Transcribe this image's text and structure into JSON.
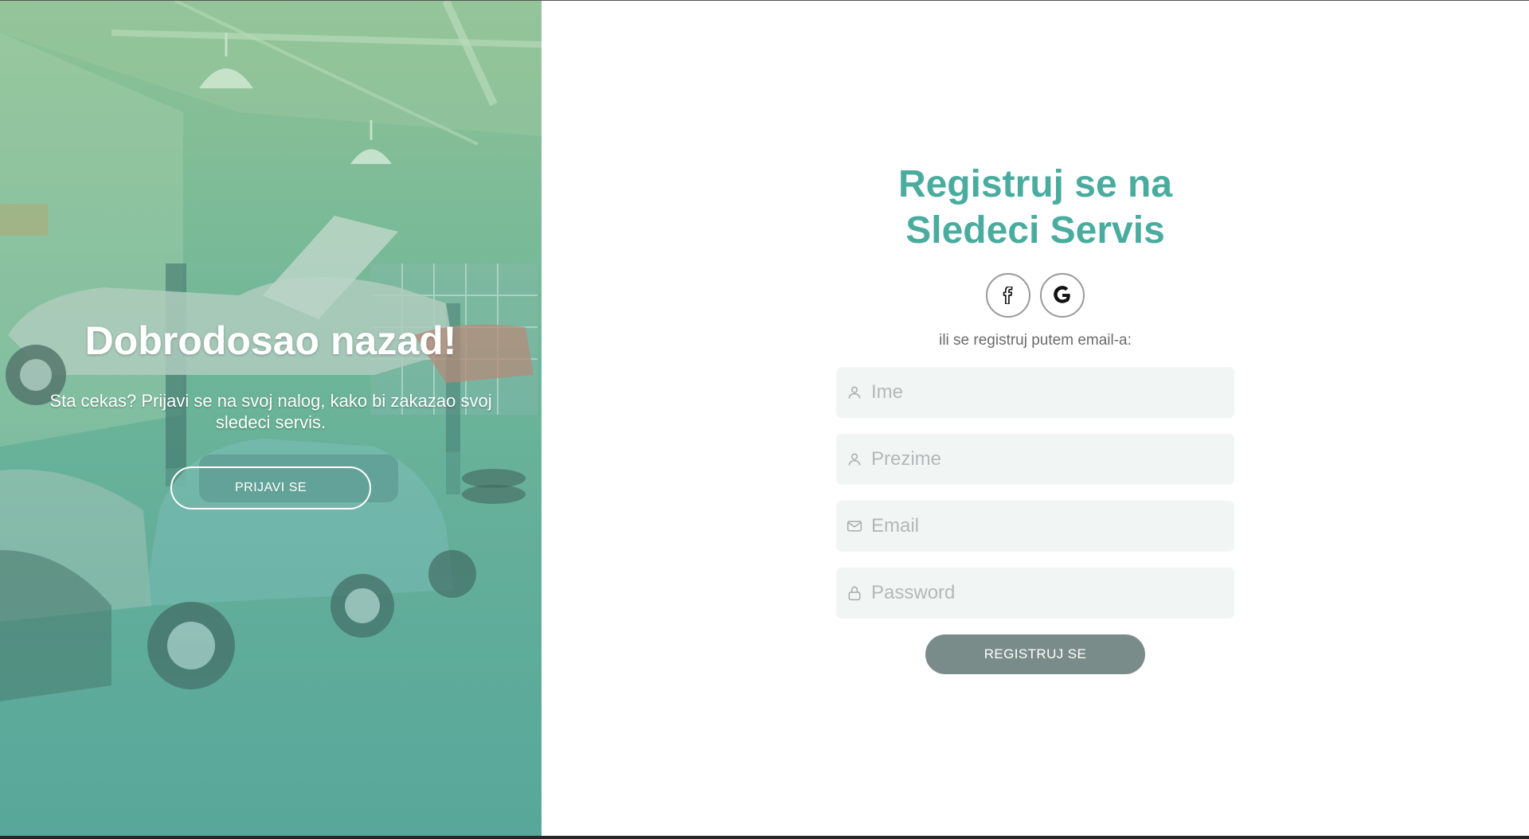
{
  "left": {
    "title": "Dobrodosao nazad!",
    "text": "Sta cekas? Prijavi se na svoj nalog, kako bi zakazao svoj sledeci servis.",
    "login_label": "PRIJAVI SE"
  },
  "form": {
    "title_line1": "Registruj se na",
    "title_line2": "Sledeci Servis",
    "social": [
      {
        "name": "facebook-icon",
        "glyph": "f"
      },
      {
        "name": "google-icon",
        "glyph": "G"
      }
    ],
    "or_text": "ili se registruj putem email-a:",
    "fields": [
      {
        "icon": "user-icon",
        "placeholder": "Ime",
        "value": ""
      },
      {
        "icon": "user-icon",
        "placeholder": "Prezime",
        "value": ""
      },
      {
        "icon": "mail-icon",
        "placeholder": "Email",
        "value": ""
      },
      {
        "icon": "lock-icon",
        "placeholder": "Password",
        "value": ""
      }
    ],
    "register_label": "REGISTRUJ SE"
  },
  "colors": {
    "accent": "#4aac9e",
    "register_button": "#7a8c89",
    "field_bg": "#f1f5f4",
    "left_gradient_top": "#8fbf95",
    "left_gradient_bottom": "#5aa79a"
  }
}
